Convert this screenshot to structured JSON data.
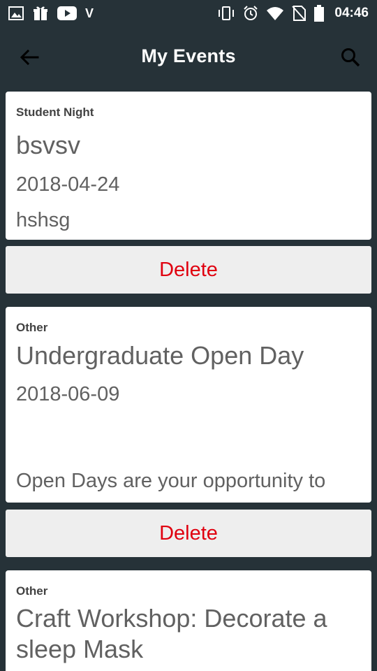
{
  "status_bar": {
    "time": "04:46",
    "left_icons": [
      "image-icon",
      "gift-icon",
      "youtube-icon",
      "v-icon"
    ],
    "right_icons": [
      "vibrate-icon",
      "alarm-icon",
      "wifi-icon",
      "no-sim-icon",
      "battery-icon"
    ],
    "v_label": "V"
  },
  "app_bar": {
    "title": "My Events",
    "back_icon": "back-arrow-icon",
    "search_icon": "search-icon"
  },
  "events": [
    {
      "category": "Student Night",
      "title": "bsvsv",
      "date": "2018-04-24",
      "description": "hshsg"
    },
    {
      "category": "Other",
      "title": "Undergraduate Open Day",
      "date": "2018-06-09",
      "description": "Open Days are your opportunity to"
    },
    {
      "category": "Other",
      "title": "Craft Workshop: Decorate a sleep Mask"
    }
  ],
  "delete_label": "Delete",
  "colors": {
    "background": "#263238",
    "card": "#ffffff",
    "delete_text": "#e0000f",
    "delete_bg": "#eeeeee"
  }
}
